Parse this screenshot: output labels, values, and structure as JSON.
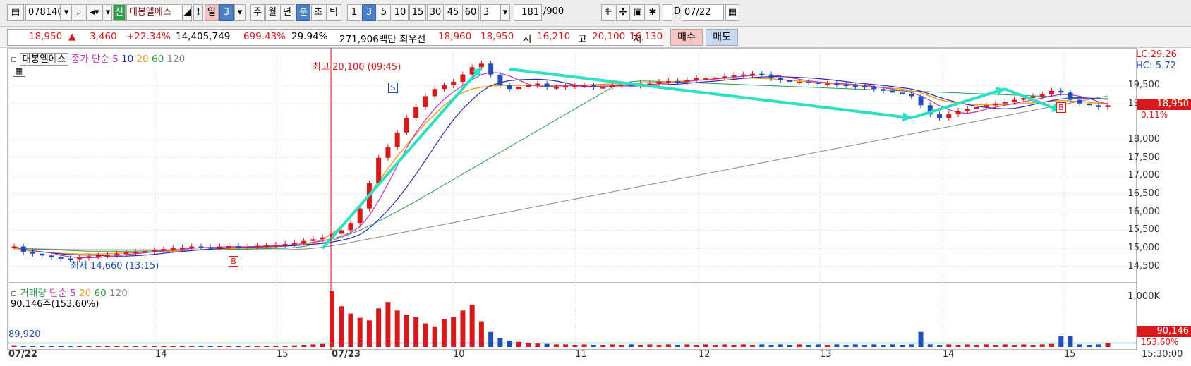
{
  "toolbar": {
    "code": "078140",
    "name": "대봉엘에스",
    "badge": "신",
    "exclaim": "!",
    "periods": [
      "일",
      "3",
      "주",
      "월",
      "년",
      "분",
      "초",
      "틱"
    ],
    "minutes": [
      "1",
      "3",
      "5",
      "10",
      "15",
      "30",
      "45",
      "60"
    ],
    "interval_value": "3",
    "count": "181",
    "count_total": "/900",
    "date": "07/22",
    "d_label": "D"
  },
  "quote": {
    "price": "18,950",
    "change": "3,460",
    "change_pct": "+22.34%",
    "volume": "14,405,749",
    "volume_ratio": "699.43%",
    "turnover": "29.94%",
    "amount": "271,906백만",
    "best_label": "최우선",
    "ask": "18,960",
    "bid": "18,950",
    "open_label": "시",
    "open": "16,210",
    "high_label": "고",
    "high": "20,100",
    "low_label": "저",
    "low": "16,130",
    "buy_label": "매수",
    "sell_label": "매도"
  },
  "price_panel": {
    "legend_name": "대봉엘에스",
    "ma_label": "종가 단순",
    "ma_periods": [
      "5",
      "10",
      "20",
      "60",
      "120"
    ],
    "high_annotation": "최고 20,100 (09:45)",
    "low_annotation": "최저 14,660 (13:15)",
    "lc": "LC:29.26",
    "hc": "HC:-5.72",
    "current_tag": "18,950",
    "current_pct": "0.11%",
    "signal_s": "S",
    "signal_b": "B",
    "yticks": [
      "19,500",
      "19,000",
      "18,000",
      "17,500",
      "17,000",
      "16,500",
      "16,000",
      "15,500",
      "15,000",
      "14,500"
    ]
  },
  "volume_panel": {
    "legend_name": "거래량",
    "ma_label": "단순",
    "ma_periods": [
      "5",
      "20",
      "60",
      "120"
    ],
    "current": "90,146주(153.60%)",
    "left_value": "89,920",
    "ytick": "1,000K",
    "tag_value": "90,146",
    "tag_pct": "153.60%"
  },
  "xaxis": {
    "labels": [
      "07/22",
      "14",
      "15",
      "07/23",
      "10",
      "11",
      "12",
      "13",
      "14",
      "15"
    ],
    "time": "15:30:00"
  },
  "chart_data": {
    "type": "candlestick",
    "ylim": [
      14300,
      20300
    ],
    "yticks": [
      19500,
      19000,
      18000,
      17500,
      17000,
      16500,
      16000,
      15500,
      15000,
      14500
    ],
    "close": [
      15050,
      14900,
      14850,
      14800,
      14750,
      14720,
      14700,
      14740,
      14780,
      14800,
      14820,
      14850,
      14880,
      14900,
      14920,
      14950,
      14980,
      15000,
      15020,
      15050,
      15030,
      15020,
      15050,
      15060,
      15040,
      15050,
      15070,
      15080,
      15100,
      15120,
      15150,
      15200,
      15250,
      15300,
      15400,
      15500,
      15700,
      16100,
      16800,
      17500,
      17800,
      18200,
      18600,
      18900,
      19200,
      19400,
      19500,
      19600,
      19800,
      20000,
      20100,
      19800,
      19500,
      19400,
      19450,
      19500,
      19550,
      19450,
      19450,
      19480,
      19500,
      19500,
      19450,
      19450,
      19500,
      19520,
      19500,
      19550,
      19550,
      19600,
      19620,
      19600,
      19650,
      19700,
      19700,
      19720,
      19750,
      19780,
      19800,
      19820,
      19800,
      19700,
      19650,
      19600,
      19600,
      19580,
      19550,
      19550,
      19520,
      19500,
      19480,
      19450,
      19400,
      19350,
      19300,
      19250,
      19200,
      18950,
      18700,
      18600,
      18700,
      18800,
      18850,
      18900,
      18950,
      19000,
      19050,
      19100,
      19150,
      19200,
      19250,
      19350,
      19300,
      19100,
      19000,
      18950,
      18900,
      18950
    ],
    "ma20": [
      15000,
      14950,
      14920,
      14900,
      14880,
      14860,
      14850,
      14840,
      14840,
      14840,
      14850,
      14860,
      14870,
      14880,
      14890,
      14900,
      14910,
      14920,
      14930,
      14950,
      14960,
      14970,
      14980,
      14990,
      15000,
      15010,
      15020,
      15030,
      15040,
      15060,
      15080,
      15100,
      15150,
      15250,
      15400,
      15600,
      15850,
      16150,
      16500,
      16850,
      17200,
      17550,
      17850,
      18150,
      18450,
      18700,
      18950,
      19150,
      19300,
      19400,
      19450,
      19480,
      19500,
      19500,
      19500,
      19500,
      19500,
      19500,
      19500,
      19500,
      19500,
      19510,
      19520,
      19530,
      19540,
      19550,
      19560,
      19570,
      19580,
      19590,
      19600,
      19610,
      19620,
      19640,
      19660,
      19680,
      19700,
      19700,
      19700,
      19700,
      19690,
      19680,
      19660,
      19640,
      19620,
      19600,
      19580,
      19560,
      19540,
      19520,
      19500,
      19480,
      19460,
      19440,
      19420,
      19400,
      19350,
      19300,
      19200,
      19100,
      19050,
      19000,
      18980,
      18970,
      18960,
      18960,
      18970,
      18980,
      19000,
      19020,
      19040,
      19060,
      19080,
      19070,
      19050,
      19030,
      19010,
      19000
    ],
    "ma60": [
      15000,
      14990,
      14980,
      14970,
      14960,
      14950,
      14940,
      14930,
      14920,
      14920,
      14920,
      14920,
      14920,
      14920,
      14925,
      14930,
      14935,
      14940,
      14945,
      14950,
      14955,
      14960,
      14965,
      14970,
      14975,
      14980,
      14985,
      14990,
      14995,
      15000,
      15020,
      15050,
      15100,
      15150,
      15220,
      15300,
      15400,
      15500,
      15620,
      15750,
      15880,
      16020,
      16160,
      16300,
      16450,
      16600,
      16750,
      16900,
      17050,
      17200,
      17350,
      17500,
      17650,
      17800,
      17950,
      18100,
      18250,
      18400,
      18550,
      18700,
      18850,
      19000,
      19150,
      19300,
      19450,
      19550,
      19600,
      19620,
      19620,
      19610,
      19600,
      19590,
      19580,
      19570,
      19560,
      19550,
      19540,
      19530,
      19520,
      19510,
      19500,
      19490,
      19480,
      19470,
      19460,
      19450,
      19440,
      19430,
      19420,
      19410,
      19400,
      19390,
      19380,
      19370,
      19360,
      19350,
      19340,
      19330,
      19320,
      19310,
      19300,
      19290,
      19280,
      19270,
      19260,
      19250,
      19240,
      19230,
      19220,
      19210,
      19200,
      19190,
      19180,
      19170,
      19160,
      19150,
      19140,
      19130
    ],
    "ma120": [
      15000,
      14990,
      14985,
      14980,
      14975,
      14970,
      14965,
      14960,
      14960,
      14960,
      14960,
      14960,
      14960,
      14960,
      14960,
      14960,
      14960,
      14960,
      14960,
      14960,
      14960,
      14960,
      14960,
      14960,
      14960,
      14960,
      14960,
      14960,
      14960,
      14960,
      14970,
      14980,
      15000,
      15030,
      15070,
      15110,
      15160,
      15210,
      15260,
      15310,
      15360,
      15410,
      15460,
      15510,
      15560,
      15610,
      15660,
      15710,
      15760,
      15810,
      15860,
      15910,
      15960,
      16010,
      16060,
      16110,
      16160,
      16210,
      16260,
      16310,
      16360,
      16410,
      16460,
      16510,
      16560,
      16610,
      16660,
      16710,
      16760,
      16810,
      16860,
      16910,
      16960,
      17010,
      17060,
      17110,
      17160,
      17210,
      17260,
      17310,
      17360,
      17410,
      17460,
      17510,
      17560,
      17610,
      17660,
      17710,
      17760,
      17810,
      17860,
      17910,
      17960,
      18010,
      18060,
      18110,
      18160,
      18210,
      18260,
      18310,
      18360,
      18410,
      18460,
      18510,
      18560,
      18610,
      18660,
      18710,
      18760,
      18810,
      18860,
      18910,
      18960,
      19010,
      19060,
      19110,
      19160,
      19210
    ],
    "volume_ylim": [
      0,
      1300000
    ],
    "volume": [
      40000,
      30000,
      20000,
      25000,
      20000,
      30000,
      20000,
      25000,
      20000,
      20000,
      25000,
      20000,
      30000,
      20000,
      25000,
      20000,
      30000,
      20000,
      25000,
      20000,
      30000,
      25000,
      20000,
      30000,
      25000,
      20000,
      30000,
      25000,
      35000,
      30000,
      40000,
      50000,
      60000,
      70000,
      1300000,
      950000,
      780000,
      680000,
      620000,
      900000,
      1050000,
      850000,
      750000,
      700000,
      550000,
      480000,
      650000,
      700000,
      850000,
      990000,
      600000,
      350000,
      200000,
      150000,
      120000,
      90000,
      80000,
      70000,
      60000,
      60000,
      50000,
      60000,
      50000,
      50000,
      60000,
      50000,
      60000,
      50000,
      60000,
      50000,
      60000,
      50000,
      60000,
      50000,
      60000,
      50000,
      60000,
      50000,
      60000,
      50000,
      60000,
      50000,
      60000,
      50000,
      60000,
      50000,
      60000,
      50000,
      60000,
      50000,
      60000,
      50000,
      60000,
      50000,
      60000,
      50000,
      60000,
      350000,
      60000,
      50000,
      60000,
      50000,
      60000,
      50000,
      60000,
      50000,
      60000,
      50000,
      60000,
      50000,
      60000,
      70000,
      250000,
      250000,
      60000,
      50000,
      60000,
      90146
    ],
    "trend_lines": [
      {
        "from": [
          33,
          15000
        ],
        "to": [
          50,
          20000
        ]
      },
      {
        "from": [
          53,
          19950
        ],
        "to": [
          96,
          18600
        ]
      },
      {
        "from": [
          96,
          18600
        ],
        "to": [
          106,
          19400
        ]
      },
      {
        "from": [
          106,
          19400
        ],
        "to": [
          112,
          18800
        ]
      }
    ],
    "x_labels": [
      "07/22",
      "14",
      "15",
      "07/23",
      "10",
      "11",
      "12",
      "13",
      "14",
      "15"
    ],
    "legend_position": "top-left",
    "grid": true,
    "colors": {
      "up": "#d7191c",
      "down": "#1f4fb8",
      "ma5": "#c033c0",
      "ma10": "#2a2ab8",
      "ma20": "#f0a020",
      "ma60": "#2a9a4a",
      "ma120": "#8a8a8a",
      "trend": "#2de0c2"
    }
  }
}
